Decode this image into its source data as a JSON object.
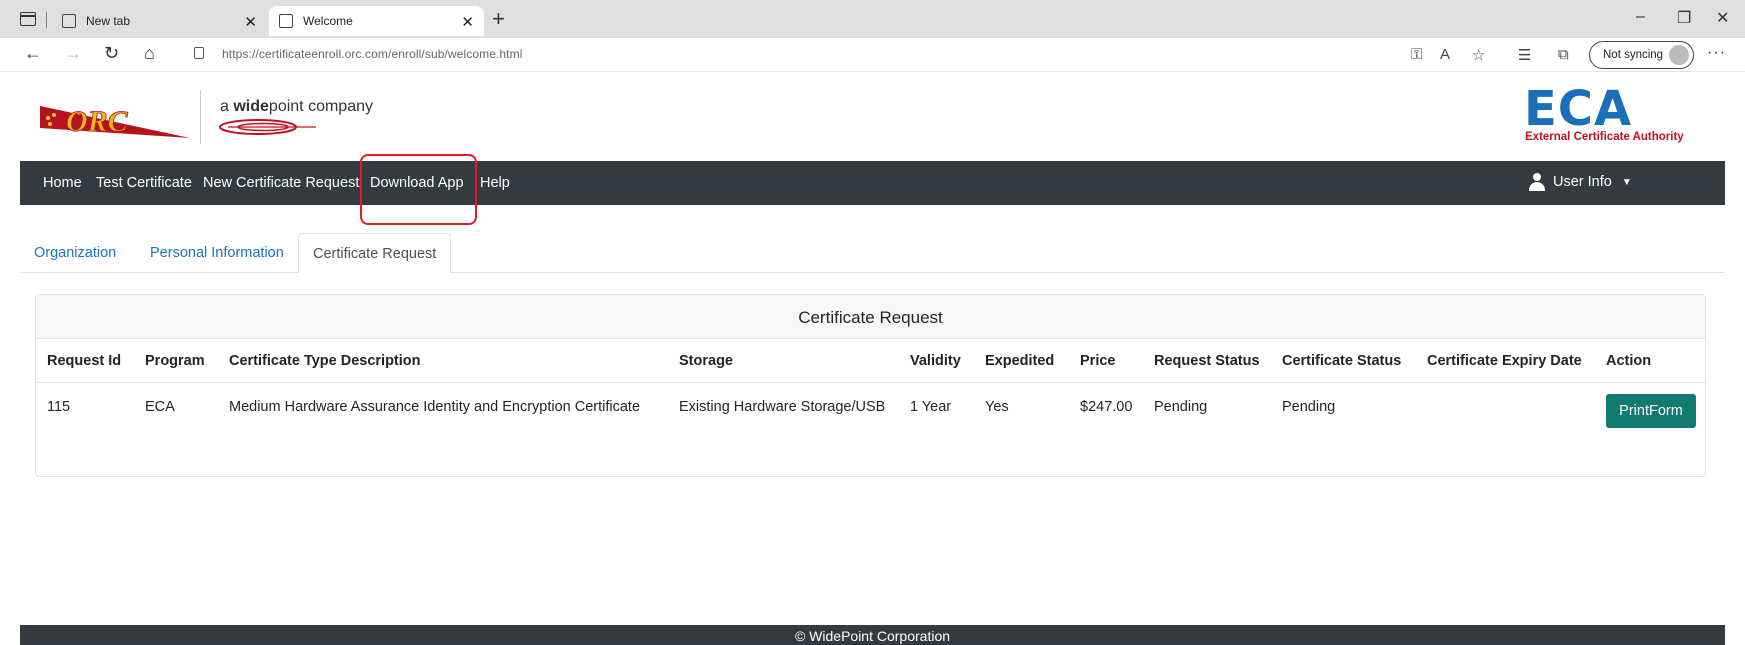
{
  "browser": {
    "tabs": [
      {
        "title": "New tab"
      },
      {
        "title": "Welcome"
      }
    ],
    "url": "https://certificateenroll.orc.com/enroll/sub/welcome.html",
    "sync_label": "Not syncing"
  },
  "header": {
    "orc_logo_text": "ORC",
    "partner_prefix": "a",
    "partner_bold": "wide",
    "partner_rest": "point company",
    "eca_mark": "ECA",
    "eca_subtitle": "External Certificate Authority"
  },
  "nav": {
    "items": [
      {
        "label": "Home"
      },
      {
        "label": "Test Certificate"
      },
      {
        "label": "New Certificate Request"
      },
      {
        "label": "Download App"
      },
      {
        "label": "Help"
      }
    ],
    "user_label": "User Info"
  },
  "tabs": [
    {
      "label": "Organization",
      "active": false
    },
    {
      "label": "Personal Information",
      "active": false
    },
    {
      "label": "Certificate Request",
      "active": true
    }
  ],
  "card": {
    "title": "Certificate Request",
    "columns": [
      "Request Id",
      "Program",
      "Certificate Type Description",
      "Storage",
      "Validity",
      "Expedited",
      "Price",
      "Request Status",
      "Certificate Status",
      "Certificate Expiry Date",
      "Action"
    ],
    "rows": [
      [
        "115",
        "ECA",
        "Medium Hardware Assurance Identity and Encryption Certificate",
        "Existing Hardware Storage/USB",
        "1 Year",
        "Yes",
        "$247.00",
        "Pending",
        "Pending",
        ""
      ]
    ],
    "action_label": "PrintForm"
  },
  "footer": {
    "text": "© WidePoint Corporation"
  },
  "colors": {
    "navbar": "#343a40",
    "link": "#1a73c9",
    "action_button": "#127a6e",
    "highlight": "#e31b23",
    "eca_blue": "#1a6fb8",
    "eca_red": "#c1121f"
  }
}
